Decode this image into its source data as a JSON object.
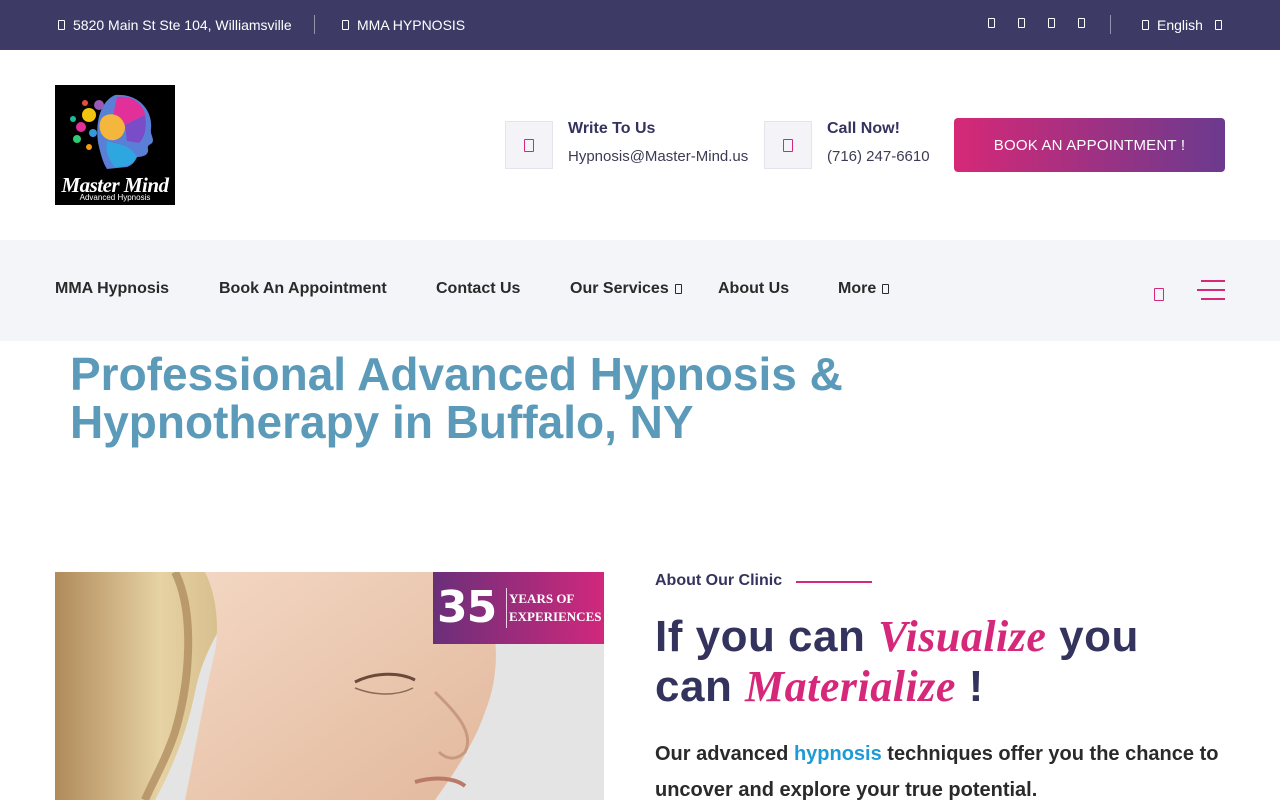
{
  "topbar": {
    "address": "5820 Main St Ste 104, Williamsville",
    "brand": "MMA HYPNOSIS",
    "language": "English",
    "social_icons": [
      "facebook-icon",
      "twitter-icon",
      "instagram-icon",
      "youtube-icon"
    ]
  },
  "header": {
    "logo": {
      "title": "Master Mind",
      "subtitle": "Advanced Hypnosis"
    },
    "email": {
      "title": "Write To Us",
      "value": "Hypnosis@Master-Mind.us",
      "icon": "envelope-icon"
    },
    "phone": {
      "title": "Call Now!",
      "value": "(716) 247-6610",
      "icon": "phone-icon"
    },
    "cta_label": "BOOK AN APPOINTMENT !"
  },
  "nav": {
    "items": [
      {
        "label": "MMA Hypnosis"
      },
      {
        "label": "Book An Appointment"
      },
      {
        "label": "Contact Us"
      },
      {
        "label": "Our Services",
        "dropdown": true
      },
      {
        "label": "About Us"
      },
      {
        "label": "More",
        "dropdown": true
      }
    ]
  },
  "hero": {
    "title_line1": "Professional Advanced Hypnosis &",
    "title_line2": "Hypnotherapy in Buffalo, NY"
  },
  "badge": {
    "number": "35",
    "line1": "YEARS OF",
    "line2": "EXPERIENCES"
  },
  "about": {
    "label": "About Our Clinic",
    "heading_part1": "If you can ",
    "heading_accent1": "Visualize",
    "heading_part2": " you",
    "heading_part3": "can ",
    "heading_accent2": "Materialize",
    "heading_part4": " !",
    "text_part1": "Our advanced ",
    "text_highlight": "hypnosis",
    "text_part2": " techniques offer you the chance to uncover and explore your true potential."
  },
  "colors": {
    "topbar": "#3d3b66",
    "accent": "#d6287a",
    "hero_title": "#5b9ab8",
    "link_highlight": "#1e9ad6"
  }
}
